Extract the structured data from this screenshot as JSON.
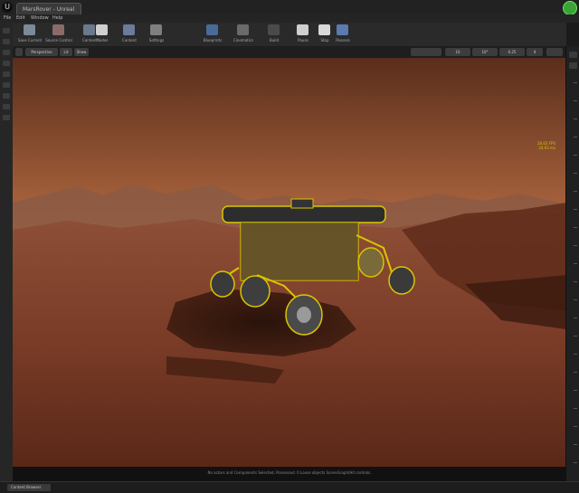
{
  "window": {
    "tab_title": "MarsRover - Unreal Editor"
  },
  "menu": {
    "items": [
      "File",
      "Edit",
      "Window",
      "Help"
    ]
  },
  "toolbar": {
    "items": [
      {
        "label": "Save Current",
        "icon": "save-icon"
      },
      {
        "label": "Source Control",
        "icon": "source-control-icon"
      },
      {
        "label": "Content",
        "icon": "content-icon"
      },
      {
        "label": "Modes",
        "icon": "modes-icon"
      },
      {
        "label": "Content",
        "icon": "content-browser-icon"
      },
      {
        "label": "Settings",
        "icon": "settings-icon"
      },
      {
        "label": "Blueprints",
        "icon": "blueprints-icon"
      },
      {
        "label": "Cinematics",
        "icon": "cinematics-icon"
      },
      {
        "label": "Build",
        "icon": "build-icon"
      },
      {
        "label": "Pause",
        "icon": "pause-icon"
      },
      {
        "label": "Stop",
        "icon": "stop-icon"
      },
      {
        "label": "Possess",
        "icon": "possess-icon"
      }
    ]
  },
  "viewport_toolbar": {
    "perspective": "Perspective",
    "lit": "Lit",
    "show": "Show",
    "grid_snap": "10",
    "rot_snap": "10°",
    "scale_snap": "0.25",
    "speed": "4"
  },
  "viewport": {
    "stats": [
      "28.63 FPS",
      "34.93 ms"
    ],
    "status_message": "No actors and Components Selected. Possessed. 0 Loose objects SceneGraph/Hit controls."
  },
  "bottom": {
    "content_browser_tab": "Content Browser"
  },
  "colors": {
    "selection_outline": "#d8c600",
    "sky": "#c77a4a",
    "ground": "#7a3a25"
  }
}
